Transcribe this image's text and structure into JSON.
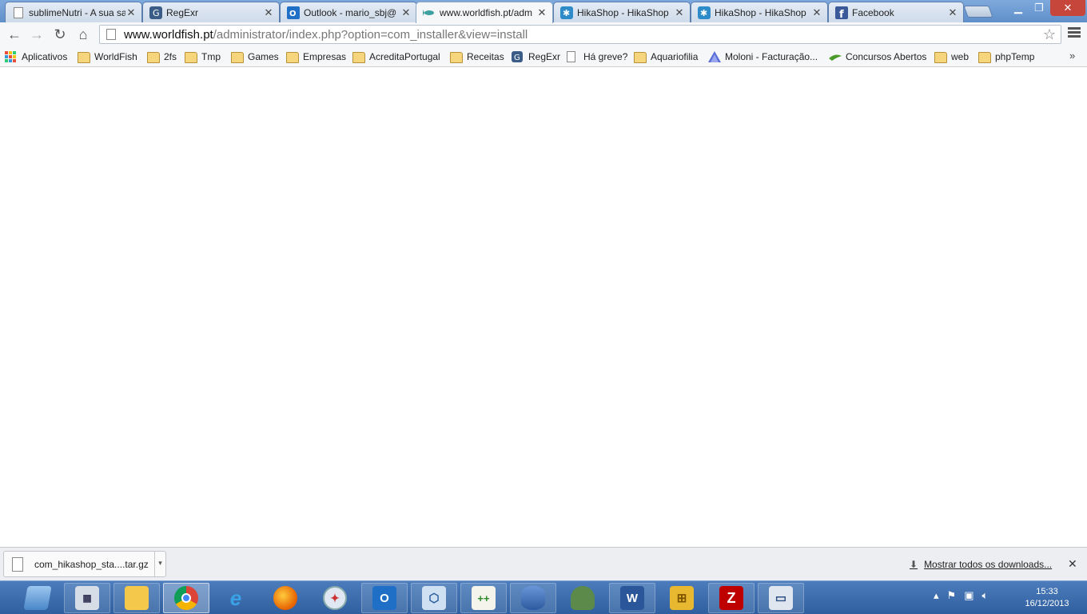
{
  "tabs": [
    {
      "title": "sublimeNutri - A sua saúde",
      "icon": "page-icon"
    },
    {
      "title": "RegExr",
      "icon": "regexr-icon"
    },
    {
      "title": "Outlook - mario_sbj@",
      "icon": "outlook-icon"
    },
    {
      "title": "www.worldfish.pt/adm",
      "icon": "worldfish-icon",
      "active": true
    },
    {
      "title": "HikaShop - HikaShop",
      "icon": "hikashop-icon"
    },
    {
      "title": "HikaShop - HikaShop",
      "icon": "hikashop-icon"
    },
    {
      "title": "Facebook",
      "icon": "facebook-icon"
    }
  ],
  "address": {
    "host": "www.worldfish.pt",
    "path": "/administrator/index.php?option=com_installer&view=install"
  },
  "bookmarks": [
    {
      "label": "Aplicativos",
      "icon": "apps-icon"
    },
    {
      "label": "WorldFish",
      "icon": "folder-icon"
    },
    {
      "label": "2fs",
      "icon": "folder-icon"
    },
    {
      "label": "Tmp",
      "icon": "folder-icon"
    },
    {
      "label": "Games",
      "icon": "folder-icon"
    },
    {
      "label": "Empresas",
      "icon": "folder-icon"
    },
    {
      "label": "AcreditaPortugal",
      "icon": "folder-icon"
    },
    {
      "label": "Receitas",
      "icon": "folder-icon"
    },
    {
      "label": "RegExr",
      "icon": "regexr-icon"
    },
    {
      "label": "Há greve?",
      "icon": "page-icon"
    },
    {
      "label": "Aquariofilia",
      "icon": "folder-icon"
    },
    {
      "label": "Moloni - Facturação...",
      "icon": "moloni-icon"
    },
    {
      "label": "Concursos Abertos",
      "icon": "concursos-icon"
    },
    {
      "label": "web",
      "icon": "folder-icon"
    },
    {
      "label": "phpTemp",
      "icon": "folder-icon"
    }
  ],
  "downloads": {
    "file_name": "com_hikashop_sta....tar.gz",
    "show_all": "Mostrar todos os downloads..."
  },
  "taskbar": {
    "apps": [
      "show-desktop",
      "calculator",
      "file-explorer",
      "chrome",
      "internet-explorer",
      "firefox",
      "safari",
      "outlook",
      "virtualbox",
      "notepad-plus-plus",
      "database",
      "tortoise",
      "word",
      "sitemap-tool",
      "filezilla",
      "remote-desktop"
    ],
    "time": "15:33",
    "date": "16/12/2013"
  },
  "colors": {
    "tab_strip": "#6b9bd2",
    "taskbar": "#3a6aab",
    "folder": "#f7d57d"
  }
}
